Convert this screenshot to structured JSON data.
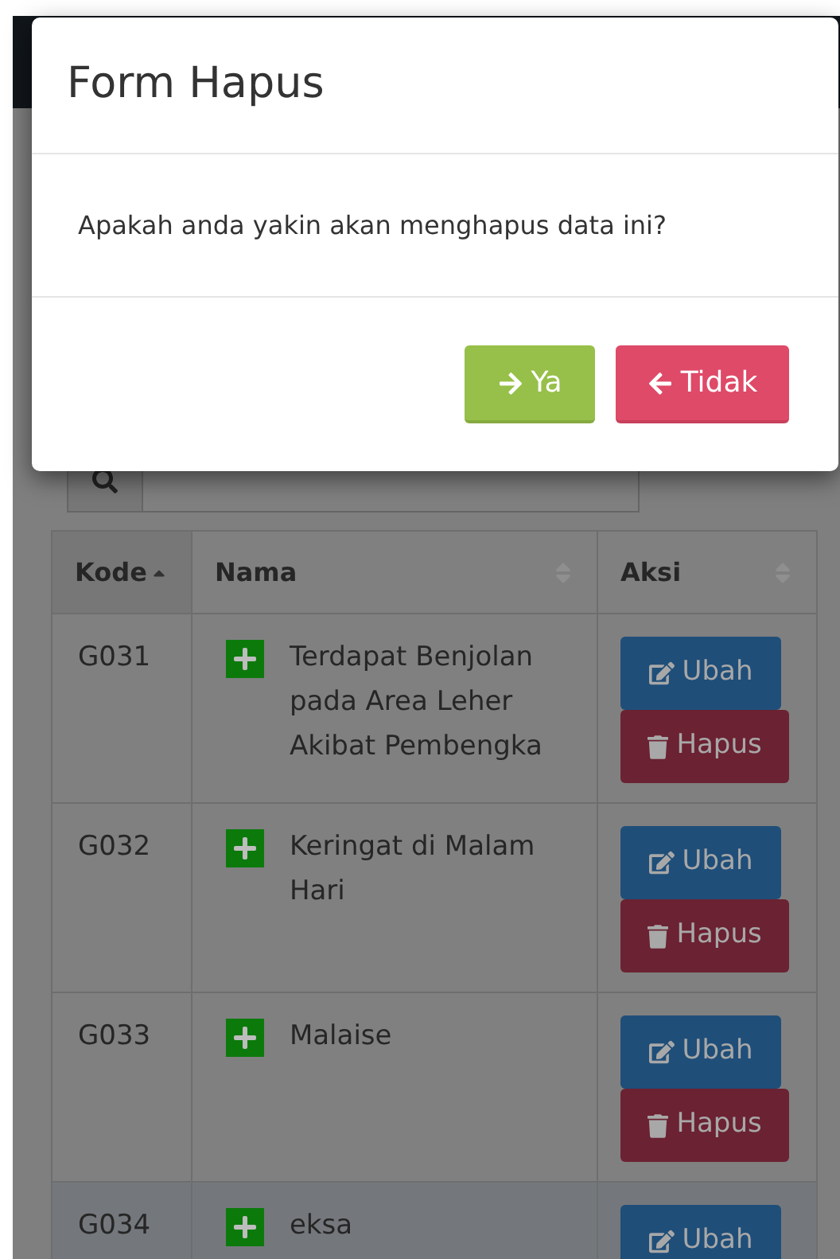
{
  "modal": {
    "title": "Form Hapus",
    "message": "Apakah anda yakin akan menghapus data ini?",
    "buttons": [
      {
        "label": "Ya",
        "kind": "confirm"
      },
      {
        "label": "Tidak",
        "kind": "cancel"
      }
    ]
  },
  "table": {
    "columns": [
      {
        "label": "Kode",
        "sorted": true
      },
      {
        "label": "Nama",
        "sorted": false
      },
      {
        "label": "Aksi",
        "sorted": false
      }
    ],
    "rows": [
      {
        "kode": "G031",
        "nama": "Terdapat Benjolan pada Area Leher Akibat Pembengka",
        "selected": false,
        "actions": [
          "Ubah",
          "Hapus"
        ]
      },
      {
        "kode": "G032",
        "nama": "Keringat di Malam Hari",
        "selected": false,
        "actions": [
          "Ubah",
          "Hapus"
        ]
      },
      {
        "kode": "G033",
        "nama": "Malaise",
        "selected": false,
        "actions": [
          "Ubah",
          "Hapus"
        ]
      },
      {
        "kode": "G034",
        "nama": "eksa",
        "selected": true,
        "actions": [
          "Ubah"
        ]
      }
    ]
  }
}
